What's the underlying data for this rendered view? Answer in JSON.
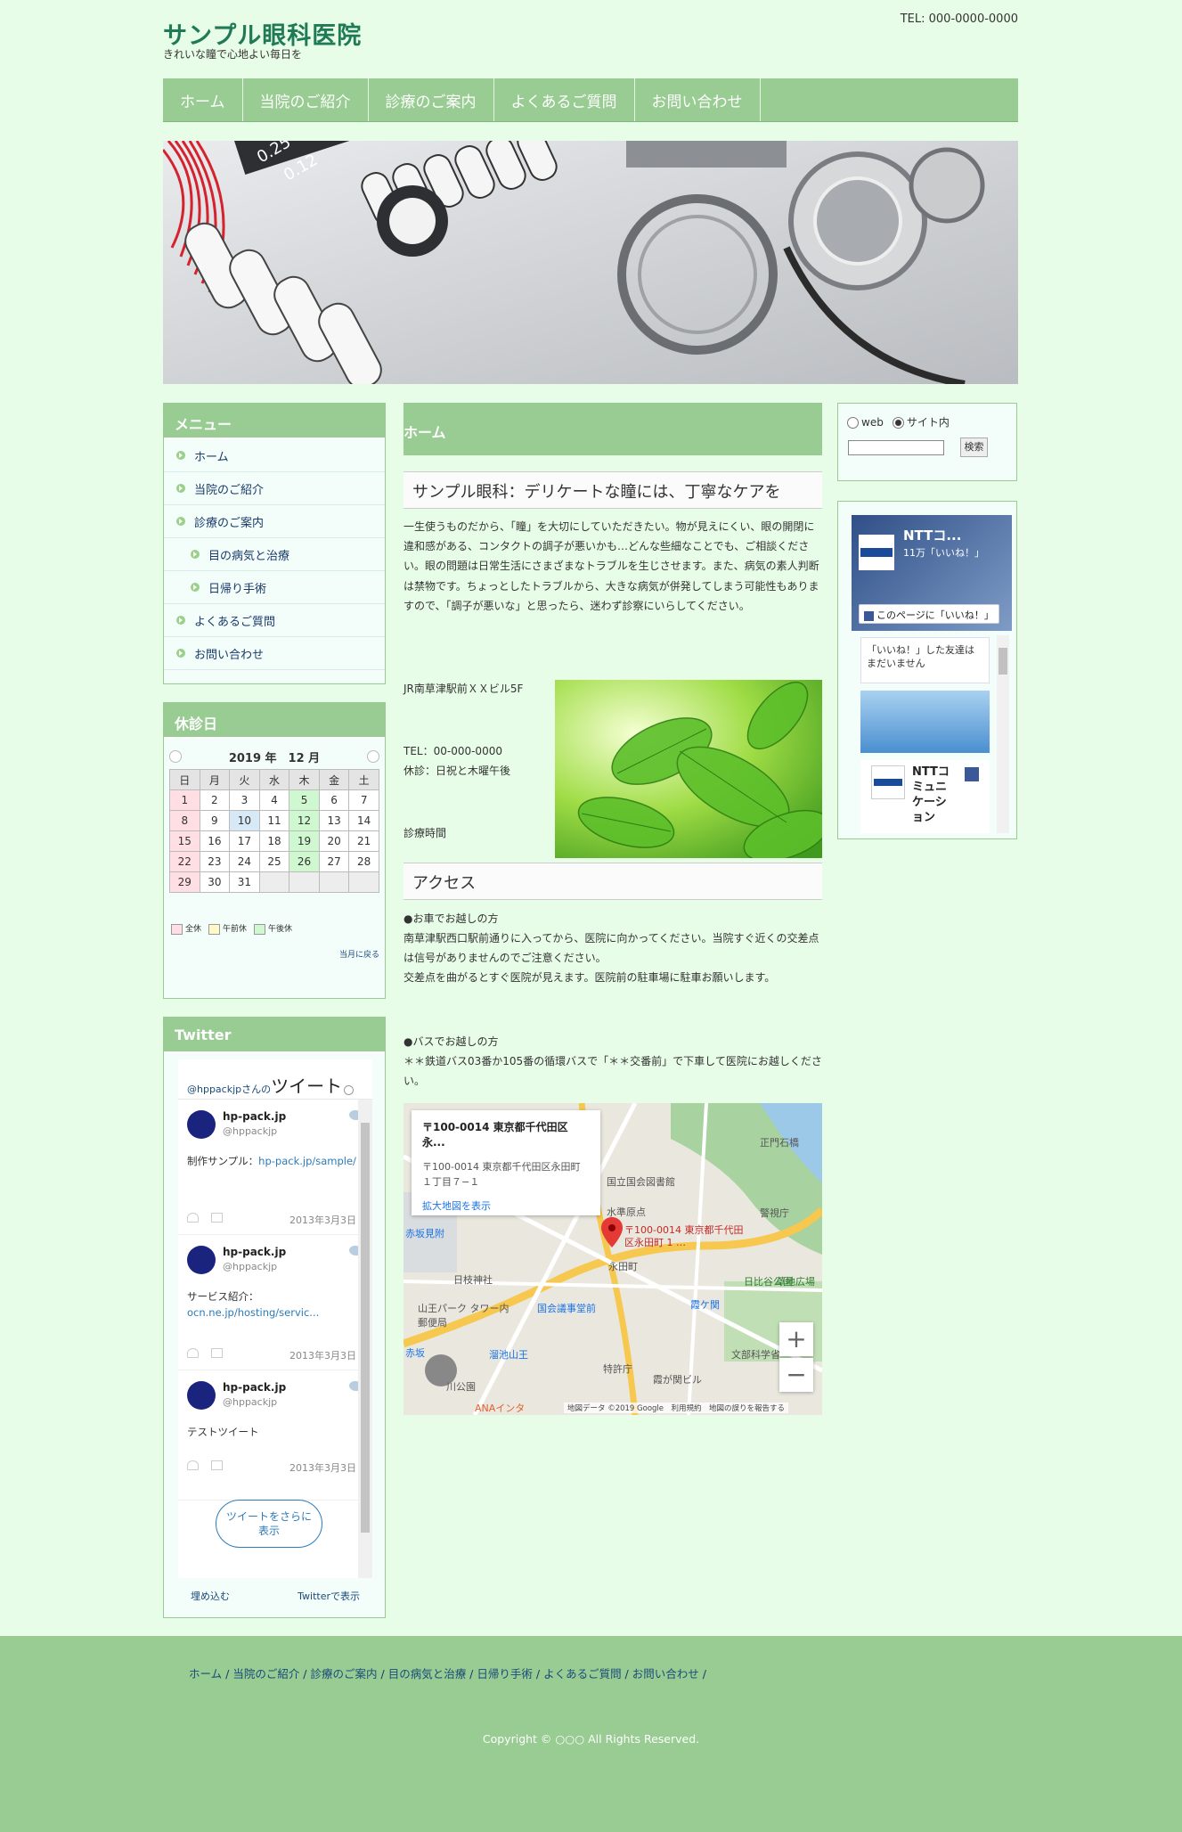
{
  "header": {
    "title": "サンプル眼科医院",
    "tagline": "きれいな瞳で心地よい毎日を",
    "tel": "TEL: 000-0000-0000"
  },
  "nav": {
    "items": [
      "ホーム",
      "当院のご紹介",
      "診療のご案内",
      "よくあるご質問",
      "お問い合わせ"
    ]
  },
  "sidebar_menu": {
    "title": "メニュー",
    "items": [
      "ホーム",
      "当院のご紹介",
      "診療のご案内",
      "目の病気と治療",
      "日帰り手術",
      "よくあるご質問",
      "お問い合わせ"
    ]
  },
  "calendar": {
    "title": "休診日",
    "month_label": "2019 年　12 月",
    "weekdays": [
      "日",
      "月",
      "火",
      "水",
      "木",
      "金",
      "土"
    ],
    "weeks": [
      [
        "1",
        "2",
        "3",
        "4",
        "5",
        "6",
        "7"
      ],
      [
        "8",
        "9",
        "10",
        "11",
        "12",
        "13",
        "14"
      ],
      [
        "15",
        "16",
        "17",
        "18",
        "19",
        "20",
        "21"
      ],
      [
        "22",
        "23",
        "24",
        "25",
        "26",
        "27",
        "28"
      ],
      [
        "29",
        "30",
        "31",
        "",
        "",
        "",
        ""
      ]
    ],
    "legend_full": "全休",
    "legend_am": "午前休",
    "legend_pm": "午後休",
    "back_label": "当月に戻る"
  },
  "twitter": {
    "title": "Twitter",
    "header_prefix": "@hppackjpさんの",
    "header_word": "ツイート",
    "tweets": [
      {
        "name": "hp-pack.jp",
        "handle": "@hppackjp",
        "text_prefix": "制作サンプル：",
        "link": "hp-pack.jp/sample/",
        "date": "2013年3月3日"
      },
      {
        "name": "hp-pack.jp",
        "handle": "@hppackjp",
        "text_prefix": "サービス紹介：",
        "link": "ocn.ne.jp/hosting/servic...",
        "date": "2013年3月3日"
      },
      {
        "name": "hp-pack.jp",
        "handle": "@hppackjp",
        "text_prefix": "テストツイート",
        "link": "",
        "date": "2013年3月3日"
      }
    ],
    "more_label": "ツイートをさらに表示",
    "embed_label": "埋め込む",
    "view_label": "Twitterで表示"
  },
  "main": {
    "page_title": "ホーム",
    "section1_title": "サンプル眼科：デリケートな瞳には、丁寧なケアを",
    "intro": "一生使うものだから、「瞳」を大切にしていただきたい。物が見えにくい、眼の開閉に違和感がある、コンタクトの調子が悪いかも…どんな些細なことでも、ご相談ください。眼の問題は日常生活にさまざまなトラブルを生じさせます。また、病気の素人判断は禁物です。ちょっとしたトラブルから、大きな病気が併発してしまう可能性もありますので、「調子が悪いな」と思ったら、迷わず診察にいらしてください。",
    "address": "JR南草津駅前ＸＸビル5F",
    "tel": "TEL：00-000-0000",
    "closed": "休診：日祝と木曜午後",
    "hours_label": "診療時間",
    "access_title": "アクセス",
    "car_heading": "●お車でお越しの方",
    "car_text": "南草津駅西口駅前通りに入ってから、医院に向かってください。当院すぐ近くの交差点は信号がありませんのでご注意ください。\n交差点を曲がるとすぐ医院が見えます。医院前の駐車場に駐車お願いします。",
    "bus_heading": "●バスでお越しの方",
    "bus_text": "＊＊鉄道バス03番か105番の循環バスで「＊＊交番前」で下車して医院にお越しください。"
  },
  "map": {
    "card_title": "〒100-0014 東京都千代田区永...",
    "card_address": "〒100-0014 東京都千代田区永田町１丁目７−１",
    "card_link": "拡大地図を表示",
    "pin_label": "〒100-0014 東京都千代田区永田町 1 …",
    "zoom_in": "+",
    "zoom_out": "−",
    "attribution": "地図データ ©2019 Google　利用規約　地図の誤りを報告する",
    "places": [
      "国立国会図書館",
      "日枝神社",
      "山王パーク タワー内郵便局",
      "国会議事堂前",
      "溜池山王",
      "霞ケ関",
      "日比谷公園",
      "文部科学省",
      "霞が関ビル",
      "赤坂見附",
      "特許庁",
      "警視庁",
      "正門石橋",
      "永田町",
      "赤坂",
      "ANAインタ",
      "草地広場",
      "水準原点",
      "川公園"
    ]
  },
  "search": {
    "option_web": "web",
    "option_site": "サイト内",
    "button": "検索"
  },
  "facebook": {
    "page_name": "NTTコ...",
    "likes": "11万「いいね！」",
    "like_button": "このページに「いいね！」",
    "no_friends": "「いいね！」した友達はまだいません",
    "post_name": "NTTコミュニケーション"
  },
  "footer": {
    "links": [
      "ホーム",
      "当院のご紹介",
      "診療のご案内",
      "目の病気と治療",
      "日帰り手術",
      "よくあるご質問",
      "お問い合わせ"
    ],
    "copyright": "Copyright © ○○○ All Rights Reserved."
  },
  "colors": {
    "accent": "#98cc92",
    "title": "#1f7a55",
    "background": "#e8fde8"
  }
}
